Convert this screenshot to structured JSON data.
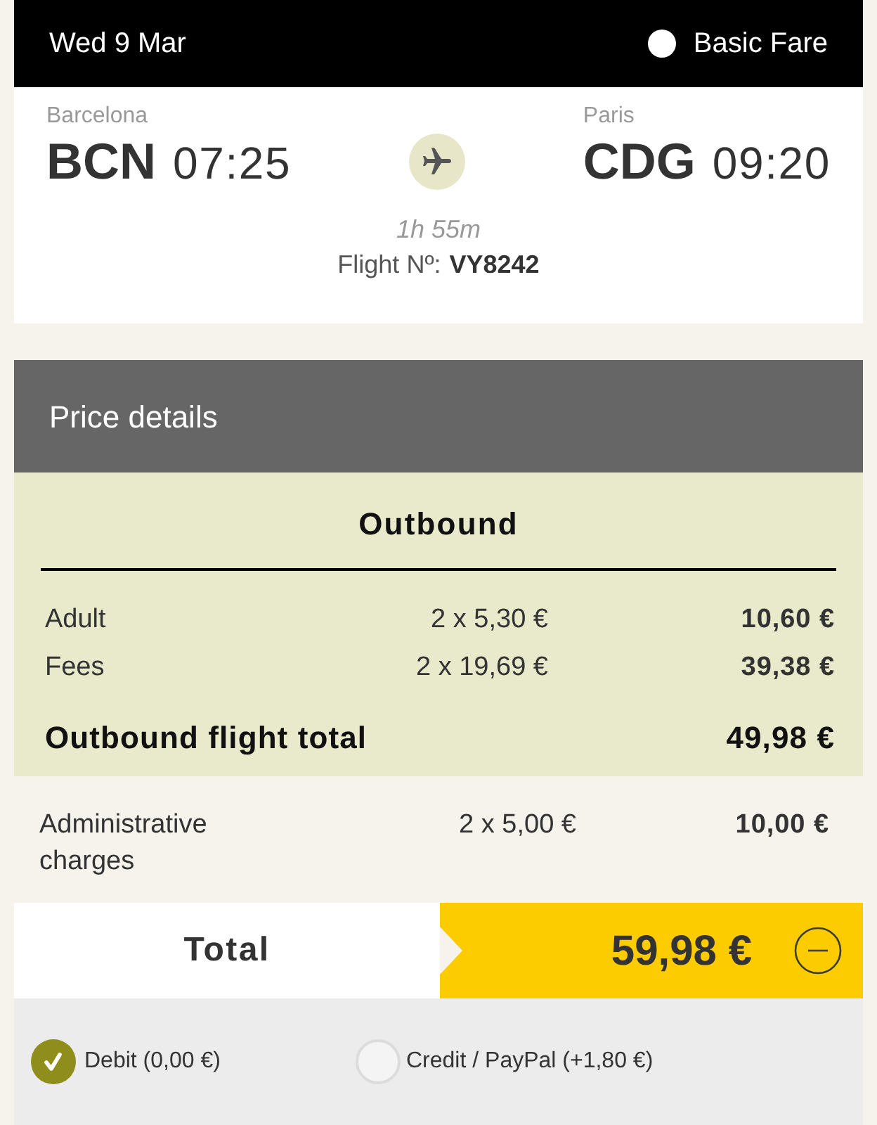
{
  "header": {
    "date": "Wed 9 Mar",
    "fare": "Basic Fare"
  },
  "flight": {
    "origin": {
      "city": "Barcelona",
      "code": "BCN",
      "time": "07:25"
    },
    "destination": {
      "city": "Paris",
      "code": "CDG",
      "time": "09:20"
    },
    "duration": "1h 55m",
    "flight_number_label": "Flight Nº:",
    "flight_number": "VY8242"
  },
  "price_details": {
    "title": "Price details",
    "section_title": "Outbound",
    "rows": [
      {
        "label": "Adult",
        "unit": "2 x 5,30 €",
        "amount": "10,60 €"
      },
      {
        "label": "Fees",
        "unit": "2 x 19,69 €",
        "amount": "39,38 €"
      }
    ],
    "subtotal": {
      "label": "Outbound flight total",
      "amount": "49,98 €"
    },
    "extra_rows": [
      {
        "label": "Administrative charges",
        "unit": "2 x 5,00 €",
        "amount": "10,00 €"
      }
    ]
  },
  "total": {
    "label": "Total",
    "amount": "59,98 €",
    "expanded": true
  },
  "payment_options": [
    {
      "label": "Debit (0,00 €)",
      "selected": true
    },
    {
      "label": "Credit / PayPal (+1,80 €)",
      "selected": false
    }
  ]
}
